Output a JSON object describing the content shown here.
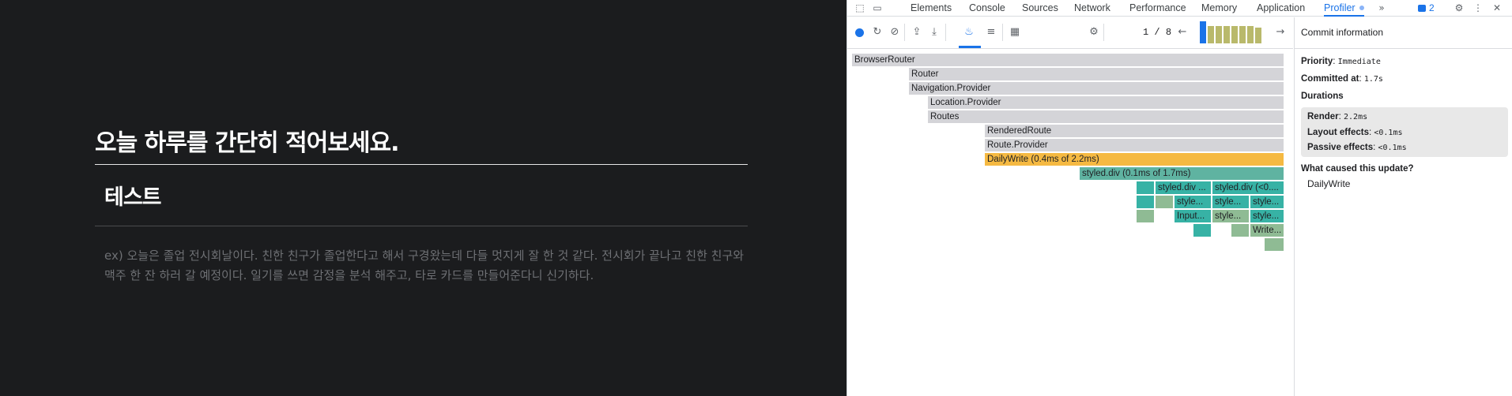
{
  "app": {
    "page_title": "오늘 하루를 간단히 적어보세요.",
    "entry_title": "테스트",
    "placeholder": "ex) 오늘은 졸업 전시회날이다. 친한 친구가 졸업한다고 해서 구경왔는데 다들 멋지게 잘 한 것 같다. 전시회가 끝나고 친한 친구와 맥주 한 잔 하러 갈 예정이다. 일기를 쓰면 감정을 분석 해주고, 타로 카드를 만들어준다니 신기하다."
  },
  "devtools": {
    "tabs": [
      "Elements",
      "Console",
      "Sources",
      "Network",
      "Performance",
      "Memory",
      "Application",
      "Profiler"
    ],
    "active_tab": "Profiler",
    "issues_count": "2",
    "commit_index": "1",
    "commit_sep": "/",
    "commit_total": "8",
    "flame_nodes": [
      "BrowserRouter",
      "Router",
      "Navigation.Provider",
      "Location.Provider",
      "Routes",
      "RenderedRoute",
      "Route.Provider",
      "DailyWrite (0.4ms of 2.2ms)",
      "styled.div (0.1ms of 1.7ms)",
      "styled.div ...",
      "styled.div (<0....",
      "style...",
      "style...",
      "style...",
      "Input...",
      "style...",
      "style...",
      "Write..."
    ],
    "commit_info": {
      "heading": "Commit information",
      "priority_label": "Priority",
      "priority_value": "Immediate",
      "committed_label": "Committed at",
      "committed_value": "1.7s",
      "durations_label": "Durations",
      "render_label": "Render",
      "render_value": "2.2ms",
      "layout_label": "Layout effects",
      "layout_value": "<0.1ms",
      "passive_label": "Passive effects",
      "passive_value": "<0.1ms",
      "cause_label": "What caused this update?",
      "cause_item": "DailyWrite"
    }
  }
}
